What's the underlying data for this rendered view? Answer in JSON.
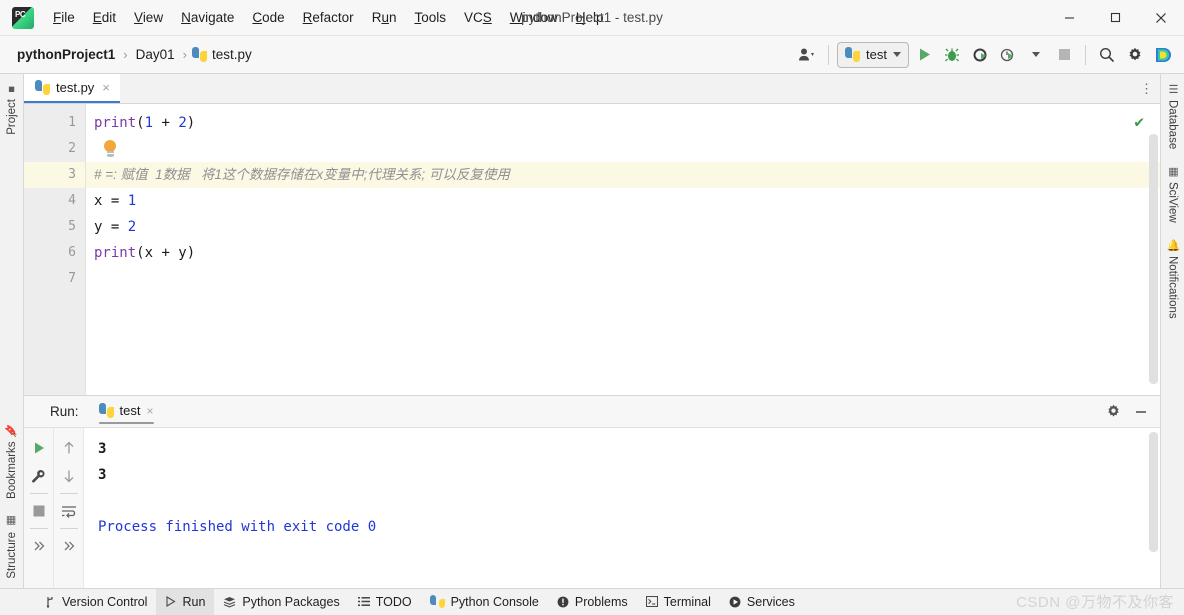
{
  "window": {
    "title": "pythonProject1 - test.py",
    "minimize_label": "minimize",
    "maximize_label": "maximize",
    "close_label": "close"
  },
  "menubar": {
    "items": [
      {
        "label": "File",
        "mnemonic": "F"
      },
      {
        "label": "Edit",
        "mnemonic": "E"
      },
      {
        "label": "View",
        "mnemonic": "V"
      },
      {
        "label": "Navigate",
        "mnemonic": "N"
      },
      {
        "label": "Code",
        "mnemonic": "C"
      },
      {
        "label": "Refactor",
        "mnemonic": "R"
      },
      {
        "label": "Run",
        "mnemonic": "u"
      },
      {
        "label": "Tools",
        "mnemonic": "T"
      },
      {
        "label": "VCS",
        "mnemonic": "S"
      },
      {
        "label": "Window",
        "mnemonic": "W"
      },
      {
        "label": "Help",
        "mnemonic": "H"
      }
    ]
  },
  "toolbar": {
    "breadcrumbs": [
      {
        "label": "pythonProject1"
      },
      {
        "label": "Day01"
      },
      {
        "label": "test.py"
      }
    ],
    "separator": "›",
    "run_config": "test",
    "buttons": [
      {
        "name": "settings-account",
        "label": "Account"
      },
      {
        "name": "run",
        "label": "Run"
      },
      {
        "name": "debug",
        "label": "Debug"
      },
      {
        "name": "run-with-coverage",
        "label": "Run with Coverage"
      },
      {
        "name": "profile",
        "label": "Profile"
      },
      {
        "name": "stop",
        "label": "Stop"
      },
      {
        "name": "search",
        "label": "Search Everywhere"
      },
      {
        "name": "settings",
        "label": "Settings"
      },
      {
        "name": "ai-assistant",
        "label": "AI Assistant"
      }
    ]
  },
  "left_rail": {
    "top": [
      {
        "label": "Project",
        "icon": "folder-icon"
      }
    ],
    "bottom": [
      {
        "label": "Bookmarks",
        "icon": "bookmark-icon"
      },
      {
        "label": "Structure",
        "icon": "structure-icon"
      }
    ]
  },
  "right_rail": {
    "items": [
      {
        "label": "Database",
        "icon": "database-icon"
      },
      {
        "label": "SciView",
        "icon": "grid-icon"
      },
      {
        "label": "Notifications",
        "icon": "bell-icon"
      }
    ]
  },
  "editor": {
    "tab": {
      "label": "test.py",
      "close": "×"
    },
    "more_menu": "⋮",
    "inspection_status": "✔",
    "line_numbers": [
      "1",
      "2",
      "3",
      "4",
      "5",
      "6",
      "7"
    ],
    "highlighted_line": 3,
    "lines": [
      {
        "n": 1,
        "type": "code",
        "tokens": [
          {
            "t": "print",
            "c": "fn"
          },
          {
            "t": "(",
            "c": "p"
          },
          {
            "t": "1",
            "c": "num"
          },
          {
            "t": " + ",
            "c": "p"
          },
          {
            "t": "2",
            "c": "num"
          },
          {
            "t": ")",
            "c": "p"
          }
        ]
      },
      {
        "n": 2,
        "type": "bulb"
      },
      {
        "n": 3,
        "type": "comment",
        "text": "# =: 赋值  1数据   将1这个数据存储在x变量中;代理关系; 可以反复使用"
      },
      {
        "n": 4,
        "type": "code",
        "tokens": [
          {
            "t": "x = ",
            "c": "p"
          },
          {
            "t": "1",
            "c": "num"
          }
        ]
      },
      {
        "n": 5,
        "type": "code",
        "tokens": [
          {
            "t": "y = ",
            "c": "p"
          },
          {
            "t": "2",
            "c": "num"
          }
        ]
      },
      {
        "n": 6,
        "type": "code",
        "tokens": [
          {
            "t": "print",
            "c": "fn"
          },
          {
            "t": "(x + y)",
            "c": "p"
          }
        ]
      },
      {
        "n": 7,
        "type": "blank"
      }
    ]
  },
  "run_panel": {
    "label": "Run:",
    "tab": {
      "label": "test",
      "close": "×"
    },
    "gear_label": "Settings",
    "minimize_label": "Hide",
    "tools": [
      {
        "name": "rerun-button",
        "label": "Rerun"
      },
      {
        "name": "up-arrow-button",
        "label": "Previous"
      },
      {
        "name": "wrench-button",
        "label": "Edit Configuration"
      },
      {
        "name": "down-arrow-button",
        "label": "Next"
      },
      {
        "name": "stop-button",
        "label": "Stop"
      },
      {
        "name": "soft-wrap-button",
        "label": "Soft-Wrap"
      },
      {
        "name": "expand-left-button",
        "label": "»"
      },
      {
        "name": "expand-right-button",
        "label": "»"
      }
    ],
    "console_lines": [
      "3",
      "3",
      "",
      "Process finished with exit code 0"
    ]
  },
  "statusbar": {
    "items": [
      {
        "label": "Version Control",
        "icon": "branch-icon",
        "active": false
      },
      {
        "label": "Run",
        "icon": "play-icon",
        "active": true
      },
      {
        "label": "Python Packages",
        "icon": "packages-icon",
        "active": false
      },
      {
        "label": "TODO",
        "icon": "list-icon",
        "active": false
      },
      {
        "label": "Python Console",
        "icon": "python-icon",
        "active": false
      },
      {
        "label": "Problems",
        "icon": "warning-icon",
        "active": false
      },
      {
        "label": "Terminal",
        "icon": "terminal-icon",
        "active": false
      },
      {
        "label": "Services",
        "icon": "services-icon",
        "active": false
      }
    ],
    "watermark": "CSDN @万物不及你客"
  },
  "colors": {
    "accent": "#3c7ad6",
    "run_green": "#59a869",
    "keyword_purple": "#7b39a8",
    "number_blue": "#2036d6",
    "comment_gray": "#909090",
    "highlight_line": "#FBF8E4"
  }
}
